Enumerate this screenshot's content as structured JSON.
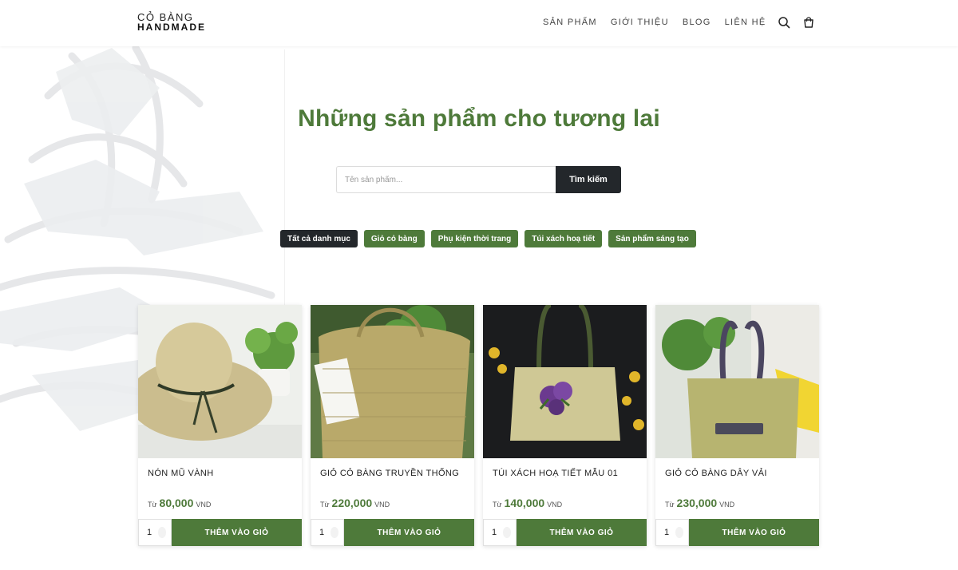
{
  "brand": {
    "line1": "CỎ BÀNG",
    "line2": "HANDMADE"
  },
  "nav": [
    "SẢN PHẨM",
    "GIỚI THIỆU",
    "BLOG",
    "LIÊN HỆ"
  ],
  "header_icons": [
    "search-icon",
    "cart-icon"
  ],
  "hero": {
    "title": "Những sản phẩm cho tương lai"
  },
  "search": {
    "placeholder": "Tên sản phẩm...",
    "button": "Tìm kiếm"
  },
  "categories": [
    {
      "label": "Tất cả danh mục",
      "active": true
    },
    {
      "label": "Giỏ cỏ bàng",
      "active": false
    },
    {
      "label": "Phụ kiện thời trang",
      "active": false
    },
    {
      "label": "Túi xách hoạ tiết",
      "active": false
    },
    {
      "label": "Sản phẩm sáng tạo",
      "active": false
    }
  ],
  "products": [
    {
      "name": "NÓN MŨ VÀNH",
      "price_prefix": "Từ",
      "price": "80,000",
      "currency": "VND",
      "qty": "1",
      "button": "THÊM VÀO GIỎ",
      "image": "straw-hat-photo"
    },
    {
      "name": "GIỎ CỎ BÀNG TRUYỀN THỐNG",
      "price_prefix": "Từ",
      "price": "220,000",
      "currency": "VND",
      "qty": "1",
      "button": "THÊM VÀO GIỎ",
      "image": "woven-basket-photo"
    },
    {
      "name": "TÚI XÁCH HOẠ TIẾT MẪU 01",
      "price_prefix": "Từ",
      "price": "140,000",
      "currency": "VND",
      "qty": "1",
      "button": "THÊM VÀO GIỎ",
      "image": "patterned-handbag-photo"
    },
    {
      "name": "GIỎ CỎ BÀNG DÂY VẢI",
      "price_prefix": "Từ",
      "price": "230,000",
      "currency": "VND",
      "qty": "1",
      "button": "THÊM VÀO GIỎ",
      "image": "fabric-strap-basket-photo"
    }
  ],
  "colors": {
    "brand_green": "#4e7a3a",
    "dark": "#23272b",
    "background": "#ffffff"
  }
}
